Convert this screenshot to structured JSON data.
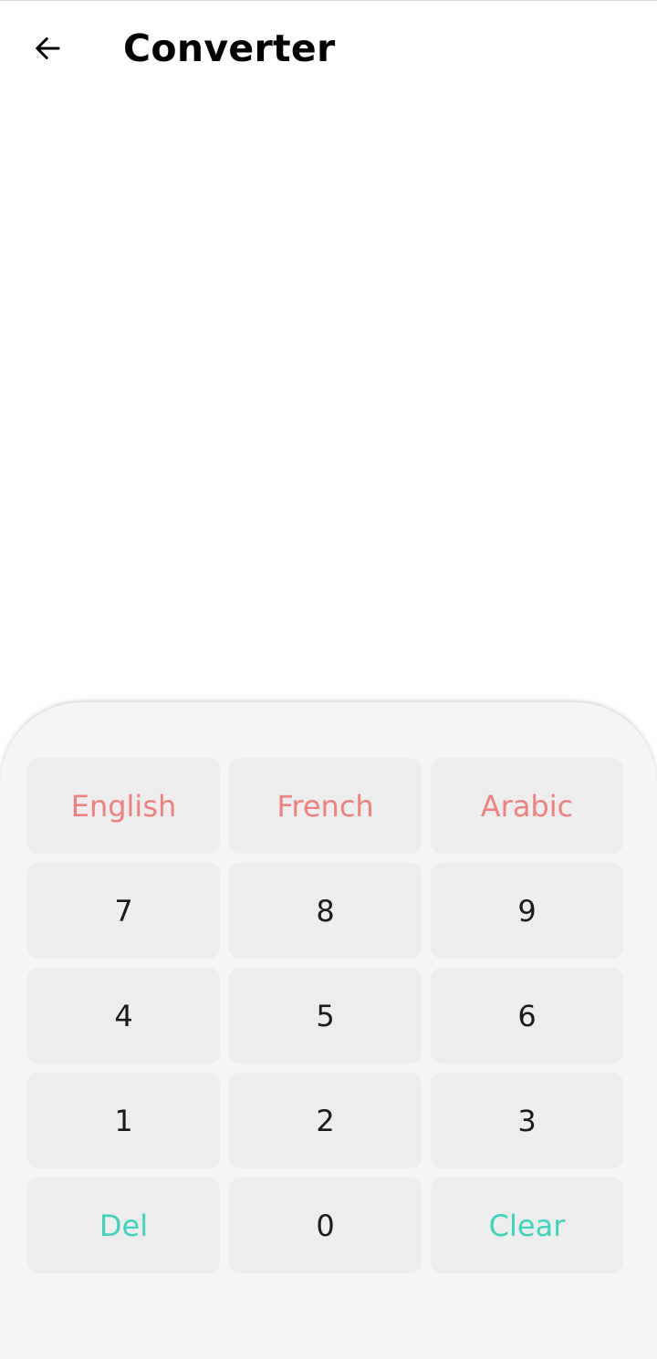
{
  "app_bar": {
    "title": "Converter",
    "back_icon": "arrow-left-icon"
  },
  "colors": {
    "language_key_text": "#ef8080",
    "action_key_text": "#3ed4bc",
    "digit_key_text": "#1a1a1a",
    "key_background": "#ededed",
    "panel_background": "#f5f5f4"
  },
  "keypad": {
    "languages": [
      "English",
      "French",
      "Arabic"
    ],
    "digits": {
      "seven": "7",
      "eight": "8",
      "nine": "9",
      "four": "4",
      "five": "5",
      "six": "6",
      "one": "1",
      "two": "2",
      "three": "3",
      "zero": "0"
    },
    "del_label": "Del",
    "clear_label": "Clear"
  }
}
